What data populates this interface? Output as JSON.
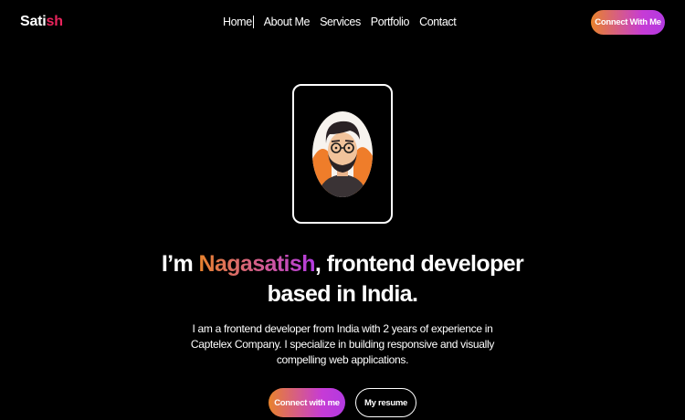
{
  "brand": {
    "logo_part1": "Sati",
    "logo_part2": "sh"
  },
  "nav": {
    "items": [
      {
        "label": "Home"
      },
      {
        "label": "About Me"
      },
      {
        "label": "Services"
      },
      {
        "label": "Portfolio"
      },
      {
        "label": "Contact"
      }
    ],
    "connect_button": "Connect With Me"
  },
  "hero": {
    "headline_prefix": "I’m ",
    "name": "Nagasatish",
    "headline_suffix": ", frontend developer",
    "headline_line2": "based in India.",
    "bio": "I am a frontend developer from India with 2 years of experience in Captelex Company. I specialize in building responsive and visually compelling web applications.",
    "primary_cta": "Connect with me",
    "secondary_cta": "My resume"
  },
  "colors": {
    "background": "#000000",
    "accent_orange": "#e8832c",
    "accent_purple": "#b23ae0",
    "logo_accent": "#e8245c"
  },
  "icons": {
    "avatar": "developer-avatar-illustration"
  }
}
